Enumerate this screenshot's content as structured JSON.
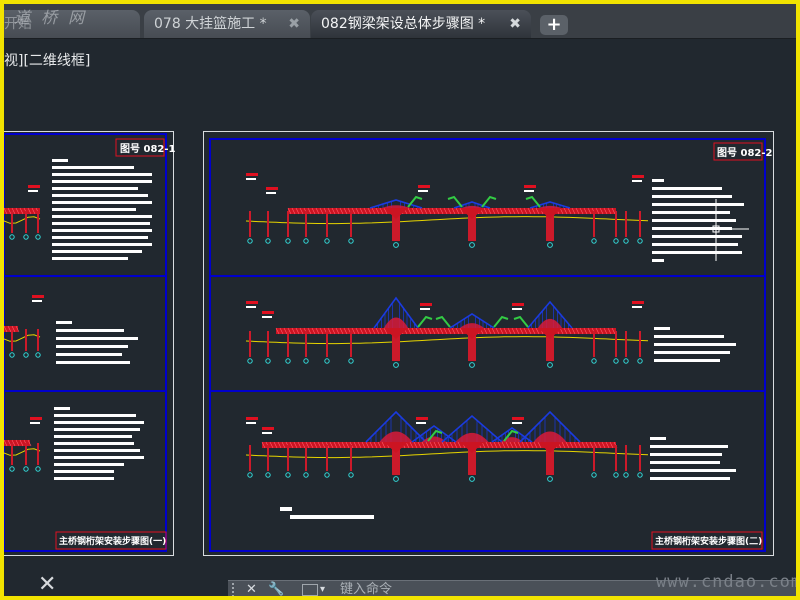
{
  "tabs": [
    {
      "label": "开始",
      "watermark": "道 桥 网"
    },
    {
      "label": "078 大挂篮施工 *"
    },
    {
      "label": "082钢梁架设总体步骤图 *"
    }
  ],
  "new_tab_label": "+",
  "viewport_label": "视][二维线框]",
  "sheets": {
    "left": {
      "number": "图号 082-1",
      "title": "主桥钢桁架安装步骤图(一)"
    },
    "right": {
      "number": "图号 082-2",
      "title": "主桥钢桁架安装步骤图(二)"
    }
  },
  "command_bar": {
    "placeholder": "键入命令"
  },
  "watermark": "www.cndao.com",
  "colors": {
    "frame_border": "#0000cc",
    "girder": "#cc1422",
    "pier": "#cc1a2a",
    "truss": "#1a3be0",
    "crane": "#33cc44",
    "alignment": "#e6d400",
    "marker": "#e01020",
    "background": "#21282f"
  }
}
